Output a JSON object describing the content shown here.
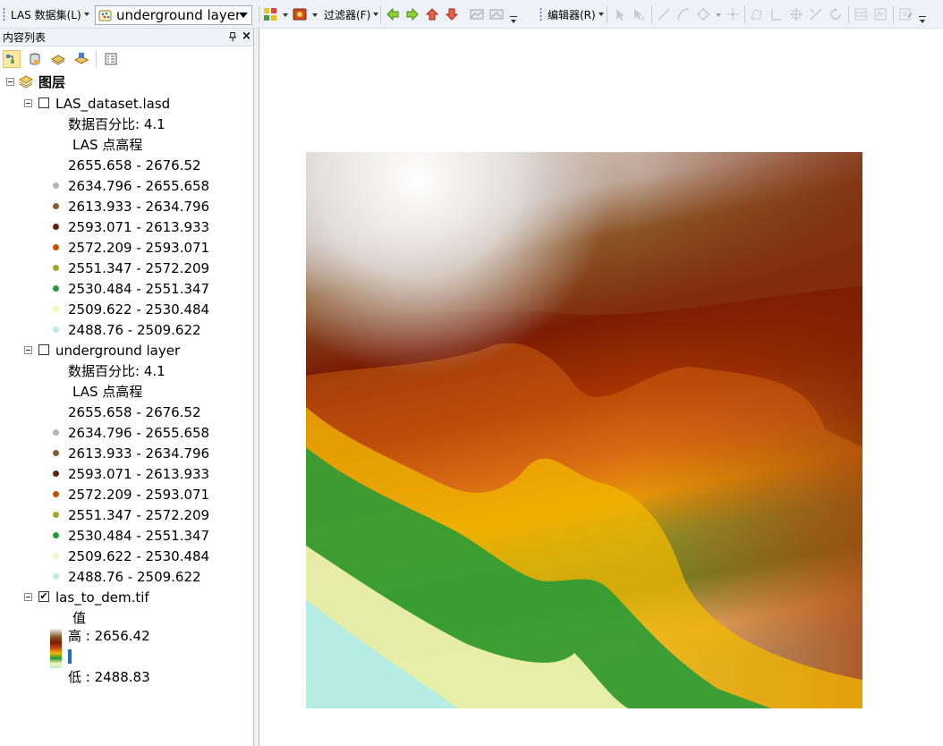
{
  "toolbar": {
    "las_dataset_menu": "LAS 数据集(L)",
    "layer_combo_value": "underground layer",
    "filter_menu": "过滤器(F)",
    "editor_menu": "编辑器(R)"
  },
  "toc": {
    "title": "内容列表",
    "pin": "ᵖ",
    "close": "×",
    "root_label": "图层",
    "layers": [
      {
        "name": "LAS_dataset.lasd",
        "checked": false,
        "percent_label": "数据百分比: 4.1",
        "renderer_label": "LAS 点高程",
        "classes": [
          {
            "label": "2655.658 - 2676.52",
            "color": "#ffffff"
          },
          {
            "label": "2634.796 - 2655.658",
            "color": "#b4b4b4"
          },
          {
            "label": "2613.933 - 2634.796",
            "color": "#8a5a33"
          },
          {
            "label": "2593.071 - 2613.933",
            "color": "#6b1e08"
          },
          {
            "label": "2572.209 - 2593.071",
            "color": "#c85000"
          },
          {
            "label": "2551.347 - 2572.209",
            "color": "#a8a820"
          },
          {
            "label": "2530.484 - 2551.347",
            "color": "#229a36"
          },
          {
            "label": "2509.622 - 2530.484",
            "color": "#f6f6b8"
          },
          {
            "label": "2488.76 - 2509.622",
            "color": "#b9ecea"
          }
        ]
      },
      {
        "name": "underground layer",
        "checked": false,
        "percent_label": "数据百分比: 4.1",
        "renderer_label": "LAS 点高程",
        "classes": [
          {
            "label": "2655.658 - 2676.52",
            "color": "#ffffff"
          },
          {
            "label": "2634.796 - 2655.658",
            "color": "#b4b4b4"
          },
          {
            "label": "2613.933 - 2634.796",
            "color": "#8a5a33"
          },
          {
            "label": "2593.071 - 2613.933",
            "color": "#6b1e08"
          },
          {
            "label": "2572.209 - 2593.071",
            "color": "#c85000"
          },
          {
            "label": "2551.347 - 2572.209",
            "color": "#a8a820"
          },
          {
            "label": "2530.484 - 2551.347",
            "color": "#229a36"
          },
          {
            "label": "2509.622 - 2530.484",
            "color": "#f6f6b8"
          },
          {
            "label": "2488.76 - 2509.622",
            "color": "#b9ecea"
          }
        ]
      },
      {
        "name": "las_to_dem.tif",
        "checked": true,
        "checkmark": "✔",
        "value_label": "值",
        "high_label": "高 : 2656.42",
        "low_label": "低 : 2488.83"
      }
    ]
  },
  "colors": {
    "toolbar_bg": "#eef1f6",
    "selection_highlight": "#fde9a6",
    "ramp": [
      "#f2f2f2",
      "#8b5a2b",
      "#7a1c04",
      "#c8501a",
      "#f2b800",
      "#1f9a3a",
      "#f9f6b4",
      "#b2ece6"
    ]
  },
  "icons": [
    "grip-icon",
    "las-layer-icon",
    "raster-symbology-icon",
    "filter-icon",
    "back-arrow-icon",
    "forward-arrow-icon",
    "up-arrow-icon",
    "down-arrow-icon",
    "profile-icon",
    "pan-icon",
    "editor-tools-icon",
    "list-by-drawing-order-icon",
    "list-by-source-icon",
    "list-by-visibility-icon",
    "list-by-selection-icon",
    "options-icon",
    "layers-group-icon"
  ]
}
